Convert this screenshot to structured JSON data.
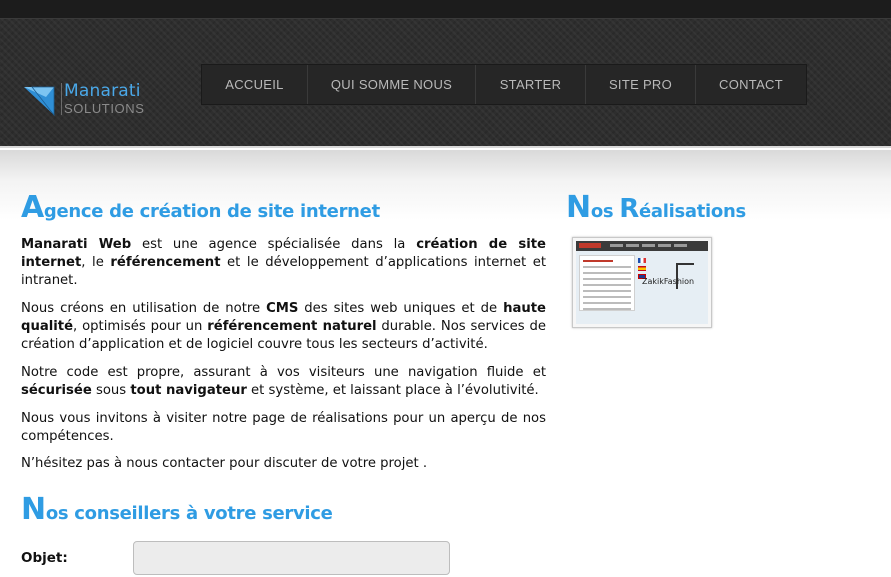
{
  "brand": {
    "name": "Manarati",
    "sub": "SOLUTIONS",
    "accent": "#4aa8e8"
  },
  "nav": {
    "items": [
      {
        "label": "ACCUEIL"
      },
      {
        "label": "QUI SOMME NOUS"
      },
      {
        "label": "STARTER"
      },
      {
        "label": "SITE PRO"
      },
      {
        "label": "CONTACT"
      }
    ]
  },
  "intro": {
    "title_first": "A",
    "title_rest": "gence de création de site internet",
    "p1_b1": "Manarati Web",
    "p1_t1": "  est une agence spécialisée dans la ",
    "p1_b2": "création de site internet",
    "p1_t2": ", le ",
    "p1_b3": "référencement",
    "p1_t3": " et le développement d’applications internet et intranet.",
    "p2_t1": "Nous créons en utilisation de notre ",
    "p2_b1": "CMS",
    "p2_t2": " des sites web uniques et de ",
    "p2_b2": "haute qualité",
    "p2_t3": ", optimisés pour un ",
    "p2_b3": "référencement naturel",
    "p2_t4": " durable. Nos services de création d’application et de logiciel couvre tous les secteurs d’activité.",
    "p3_t1": "Notre code est propre, assurant à vos visiteurs une navigation fluide et ",
    "p3_b1": "sécurisée",
    "p3_t2": " sous ",
    "p3_b2": "tout navigateur",
    "p3_t3": " et système, et laissant place à l’évolutivité.",
    "p4": "Nous vous invitons à visiter notre page de réalisations pour un aperçu de nos compétences.",
    "contact": "N’hésitez pas à nous contacter pour discuter de votre projet ."
  },
  "realisations": {
    "title_first": "N",
    "title_mid": "os ",
    "title_second": "R",
    "title_rest": "éalisations",
    "thumb_logo_a": "ZakikF",
    "thumb_logo_b": "ashion"
  },
  "advisors": {
    "title_first": "N",
    "title_rest": "os conseillers à votre service"
  },
  "form": {
    "object_label": "Objet:",
    "object_value": ""
  }
}
